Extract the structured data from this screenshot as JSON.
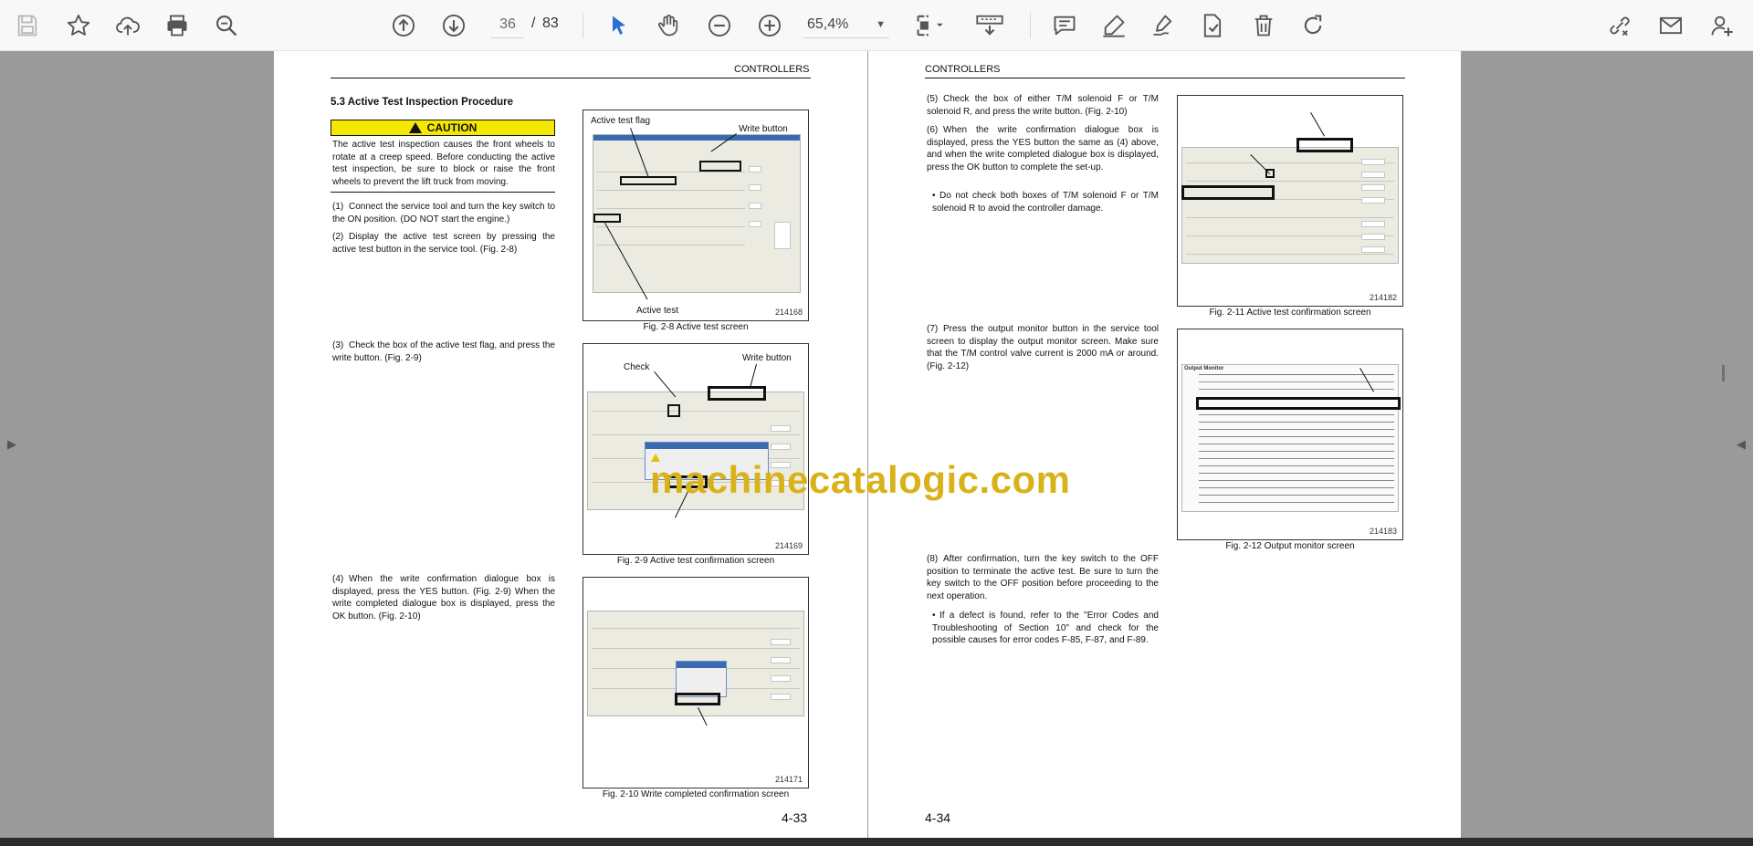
{
  "toolbar": {
    "page_current": "36",
    "page_separator": "/",
    "page_total": "83",
    "zoom": "65,4%"
  },
  "left_page": {
    "header": "CONTROLLERS",
    "section_title": "5.3   Active Test Inspection Procedure",
    "caution_label": "CAUTION",
    "caution_text": "The active test inspection causes the front wheels to rotate at a creep speed. Before conducting the active test inspection, be sure to block or raise the front wheels to prevent the lift truck from moving.",
    "steps": [
      {
        "num": "(1)",
        "text": "Connect the service tool and turn the key switch to the ON position. (DO NOT start the engine.)"
      },
      {
        "num": "(2)",
        "text": "Display the active test screen by pressing the active test button in the service tool. (Fig. 2-8)"
      },
      {
        "num": "(3)",
        "text": "Check the box of the active test flag, and press the write button. (Fig. 2-9)"
      },
      {
        "num": "(4)",
        "text": "When the write confirmation dialogue box is displayed, press the YES button. (Fig. 2-9) When the write completed dialogue box is displayed, press the OK button. (Fig. 2-10)"
      }
    ],
    "fig1": {
      "label_flag": "Active test flag",
      "label_write": "Write button",
      "label_active": "Active test",
      "id": "214168",
      "caption": "Fig. 2-8  Active test screen"
    },
    "fig2": {
      "label_check": "Check",
      "label_write": "Write button",
      "id": "214169",
      "caption": "Fig. 2-9  Active test confirmation screen"
    },
    "fig3": {
      "id": "214171",
      "caption": "Fig. 2-10  Write completed confirmation screen"
    },
    "page_number": "4-33"
  },
  "right_page": {
    "header": "CONTROLLERS",
    "steps": [
      {
        "num": "(5)",
        "text": "Check the box of either T/M solenoid F or T/M solenoid R, and press the write button. (Fig. 2-10)"
      },
      {
        "num": "(6)",
        "text": "When the write confirmation dialogue box is displayed, press the YES button the same as (4) above, and when the write completed dialogue box is displayed, press the OK button to complete the set-up."
      },
      {
        "num": "•",
        "text": "Do not check both boxes of T/M solenoid F or T/M solenoid R to avoid the controller damage."
      },
      {
        "num": "(7)",
        "text": "Press the output monitor button in the service tool screen to display the output monitor screen. Make sure that the T/M control valve current is 2000 mA or around. (Fig. 2-12)"
      },
      {
        "num": "(8)",
        "text": "After confirmation, turn the key switch to the OFF position to terminate the active test. Be sure to turn the key switch to the OFF position before proceeding to the next operation."
      },
      {
        "num": "•",
        "text": "If a defect is found, refer to the \"Error Codes and Troubleshooting of Section 10\" and check for the possible causes for error codes F-85, F-87, and F-89."
      }
    ],
    "fig4": {
      "id": "214182",
      "caption": "Fig. 2-11  Active test confirmation screen"
    },
    "fig5": {
      "id": "214183",
      "caption": "Fig. 2-12  Output monitor screen",
      "panel_title": "Output Monitor"
    },
    "page_number": "4-34"
  },
  "watermark": "machinecatalogic.com"
}
